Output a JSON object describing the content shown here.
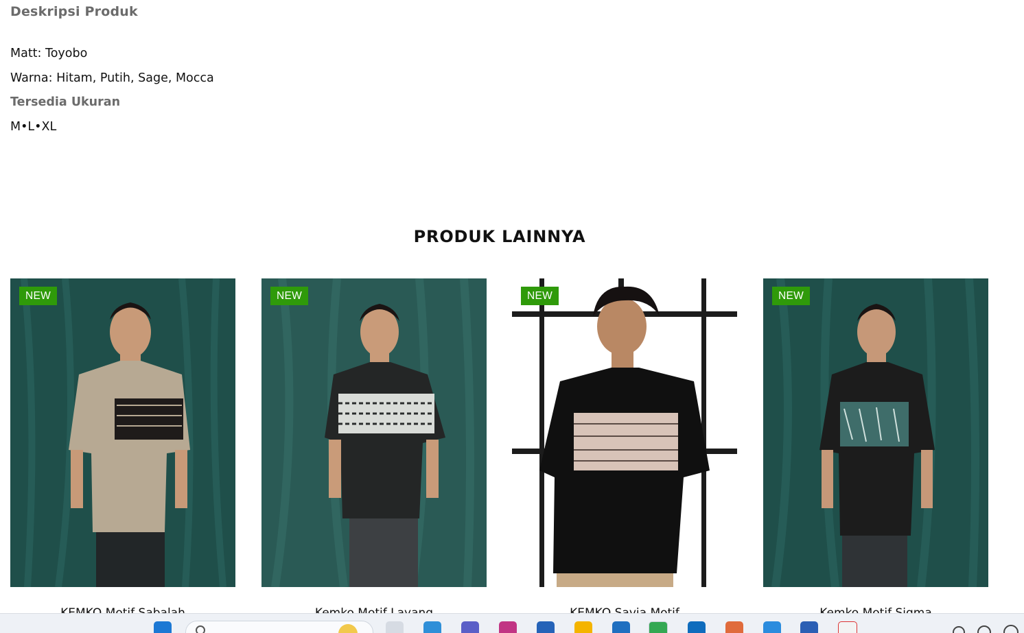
{
  "description": {
    "title": "Deskripsi Produk",
    "material": "Matt: Toyobo",
    "colors": "Warna: Hitam, Putih, Sage, Mocca",
    "sizes_heading": "Tersedia Ukuran",
    "sizes": "M•L•XL"
  },
  "related": {
    "title": "PRODUK LAINNYA",
    "products": [
      {
        "badge": "NEW",
        "name": "KEMKO Motif Sabalah",
        "shirt_color": "#b7a993",
        "pattern_color": "#1f1b1a",
        "background": "#1f4f4a"
      },
      {
        "badge": "NEW",
        "name": "Kemko Motif Layang",
        "shirt_color": "#242626",
        "pattern_color": "#d9dcd8",
        "background": "#2a5a55"
      },
      {
        "badge": "NEW",
        "name": "KEMKO Savia Motif",
        "shirt_color": "#101010",
        "pattern_color": "#d8c3b8",
        "background": "#ffffff"
      },
      {
        "badge": "NEW",
        "name": "Kemko Motif Sigma",
        "shirt_color": "#1c1c1c",
        "pattern_color": "#3f6d6a",
        "background": "#1f4f4a"
      }
    ]
  },
  "taskbar": {
    "icons": [
      "windows-start-icon",
      "search-icon",
      "weather-icon",
      "file-explorer-icon",
      "edge-icon",
      "teams-icon",
      "instagram-icon",
      "store-icon",
      "folder-icon",
      "mail-icon",
      "chrome-icon",
      "outlook-icon",
      "photos-icon",
      "vscode-icon",
      "word-icon",
      "acrobat-icon",
      "wifi-icon",
      "sync-icon",
      "clock-icon"
    ]
  }
}
